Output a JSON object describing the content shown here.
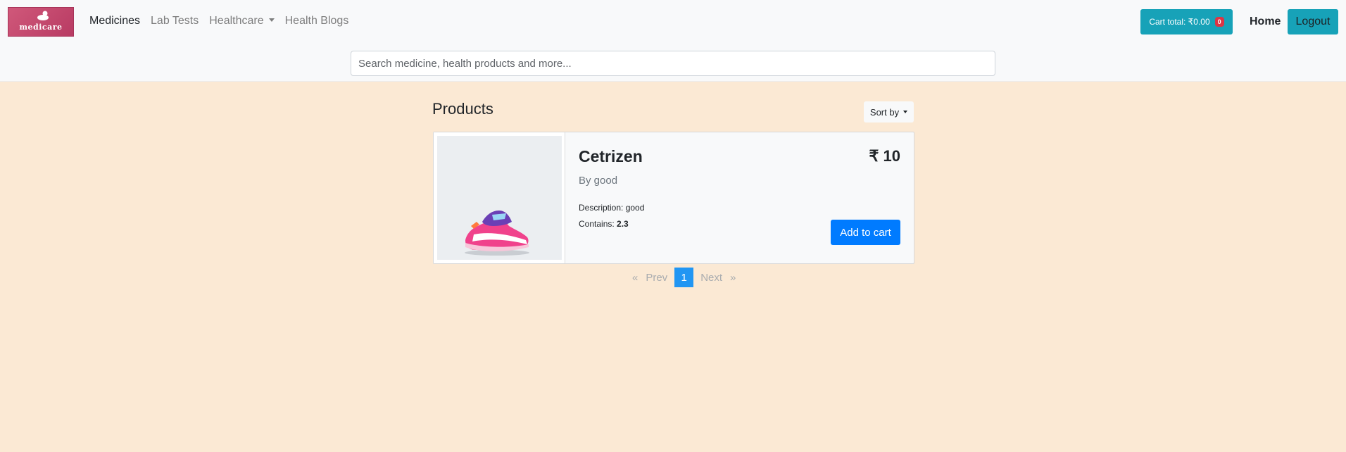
{
  "brand": {
    "logo_text": "medicare"
  },
  "nav": {
    "links": [
      "Medicines",
      "Lab Tests",
      "Healthcare",
      "Health Blogs"
    ],
    "cart_label": "Cart total: ₹0.00",
    "cart_count": "0",
    "home": "Home",
    "logout": "Logout"
  },
  "search": {
    "placeholder": "Search medicine, health products and more..."
  },
  "main": {
    "title": "Products",
    "sort_label": "Sort by"
  },
  "product": {
    "name": "Cetrizen",
    "price": "₹ 10",
    "by": "By good",
    "description_label": "Description: good",
    "contains_label": "Contains: ",
    "contains_value": "2.3",
    "add_label": "Add to cart"
  },
  "pagination": {
    "first": "«",
    "prev": "Prev",
    "current": "1",
    "next": "Next",
    "last": "»"
  },
  "colors": {
    "accent": "#17a2b8",
    "primary": "#007bff",
    "page_bg": "#fbe9d4",
    "badge": "#dc3545"
  }
}
